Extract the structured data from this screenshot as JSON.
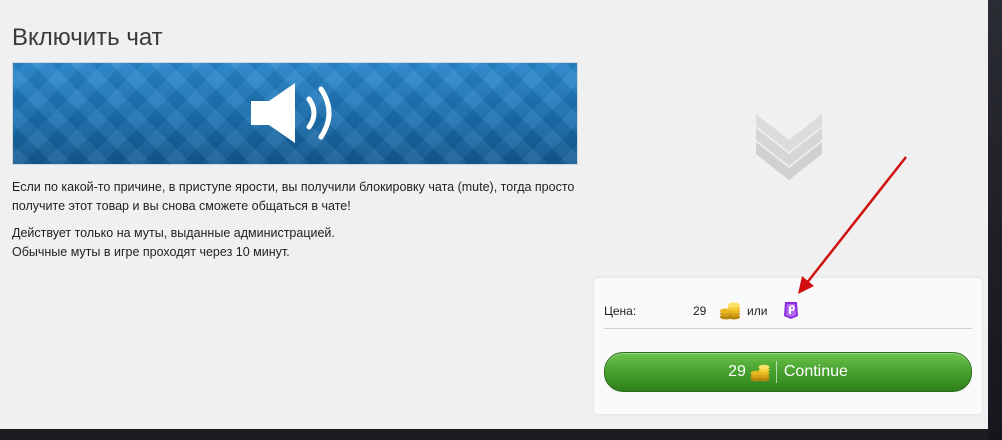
{
  "page": {
    "title": "Включить чат"
  },
  "description": {
    "line1": "Если по какой-то причине, в приступе ярости, вы получили блокировку чата (mute), тогда просто получите этот товар и вы снова сможете общаться в чате!",
    "line2": "Действует только на муты, выданные администрацией.",
    "line3": "Обычные муты в игре проходят через 10 минут."
  },
  "purchase": {
    "price_label": "Цена:",
    "gold_price": "29",
    "or_text": "или",
    "button_price": "29",
    "button_label": "Continue"
  },
  "icons": {
    "banner": "speaker-volume-icon",
    "gold": "gold-coins-icon",
    "premium": "premium-currency-icon",
    "chevrons": "chevrons-down-icon",
    "annotation": "red-arrow-annotation"
  },
  "colors": {
    "banner_blue": "#1a70b0",
    "button_green": "#46a02e",
    "arrow_red": "#d01010",
    "premium_purple": "#8a2be2"
  }
}
